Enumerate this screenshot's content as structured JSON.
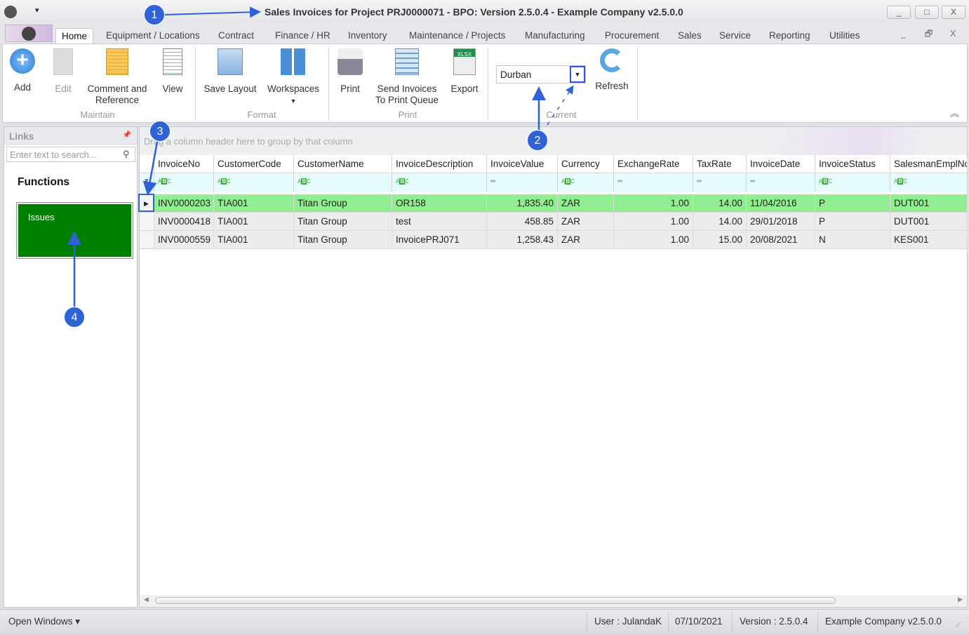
{
  "window": {
    "title": "Sales Invoices for Project PRJ0000071 - BPO: Version 2.5.0.4 - Example Company v2.5.0.0",
    "controls": [
      "_",
      "□",
      "X"
    ],
    "mdi_controls": [
      "_",
      "🗗",
      "X"
    ]
  },
  "tabs": [
    "Home",
    "Equipment / Locations",
    "Contract",
    "Finance / HR",
    "Inventory",
    "Maintenance / Projects",
    "Manufacturing",
    "Procurement",
    "Sales",
    "Service",
    "Reporting",
    "Utilities"
  ],
  "ribbon": {
    "groups": {
      "maintain": {
        "label": "Maintain",
        "buttons": [
          "Add",
          "Edit",
          "Comment and Reference",
          "View"
        ]
      },
      "format": {
        "label": "Format",
        "buttons": [
          "Save Layout",
          "Workspaces"
        ]
      },
      "print": {
        "label": "Print",
        "buttons": [
          "Print",
          "Send Invoices To Print Queue",
          "Export"
        ]
      },
      "current": {
        "label": "Current",
        "combo_value": "Durban",
        "buttons": [
          "Refresh"
        ]
      }
    }
  },
  "left_panel": {
    "header": "Links",
    "search_placeholder": "Enter text to search...",
    "functions_title": "Functions",
    "tiles": [
      {
        "label": "Issues",
        "color": "#008000"
      }
    ]
  },
  "grid": {
    "group_hint": "Drag a column header here to group by that column",
    "columns": [
      "InvoiceNo",
      "CustomerCode",
      "CustomerName",
      "InvoiceDescription",
      "InvoiceValue",
      "Currency",
      "ExchangeRate",
      "TaxRate",
      "InvoiceDate",
      "InvoiceStatus",
      "SalesmanEmplNo"
    ],
    "filter_types": [
      "abc",
      "abc",
      "abc",
      "abc",
      "=",
      "abc",
      "=",
      "=",
      "=",
      "abc",
      "abc"
    ],
    "selected_row_color": "#90ee90",
    "rows": [
      [
        "INV0000203",
        "TIA001",
        "Titan Group",
        "OR158",
        "1,835.40",
        "ZAR",
        "1.00",
        "14.00",
        "11/04/2016",
        "P",
        "DUT001"
      ],
      [
        "INV0000418",
        "TIA001",
        "Titan Group",
        "test",
        "458.85",
        "ZAR",
        "1.00",
        "14.00",
        "29/01/2018",
        "P",
        "DUT001"
      ],
      [
        "INV0000559",
        "TIA001",
        "Titan Group",
        "InvoicePRJ071",
        "1,258.43",
        "ZAR",
        "1.00",
        "15.00",
        "20/08/2021",
        "N",
        "KES001"
      ]
    ]
  },
  "statusbar": {
    "open_windows": "Open Windows ▾",
    "user": "User : JulandaK",
    "date": "07/10/2021",
    "version": "Version : 2.5.0.4",
    "company": "Example Company v2.5.0.0"
  },
  "annotations": [
    "1",
    "2",
    "3",
    "4"
  ],
  "annotation_color": "#2f62d6"
}
